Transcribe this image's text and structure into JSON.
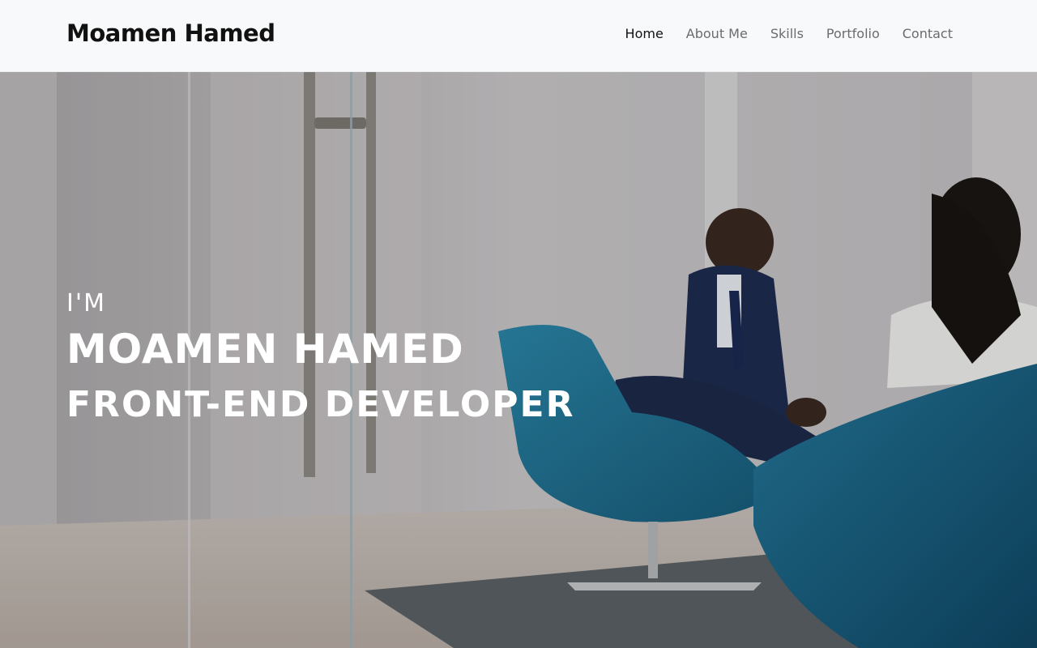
{
  "navbar": {
    "brand": "Moamen Hamed",
    "links": [
      {
        "label": "Home",
        "active": true
      },
      {
        "label": "About Me",
        "active": false
      },
      {
        "label": "Skills",
        "active": false
      },
      {
        "label": "Portfolio",
        "active": false
      },
      {
        "label": "Contact",
        "active": false
      }
    ]
  },
  "hero": {
    "intro": "I'M",
    "name": "MOAMEN HAMED",
    "role": "FRONT-END DEVELOPER",
    "background_image": "office-meeting-photo"
  },
  "colors": {
    "navbar_bg": "#f8f9fa",
    "hero_text": "#ffffff",
    "chair_blue": "#1f6f8f"
  }
}
